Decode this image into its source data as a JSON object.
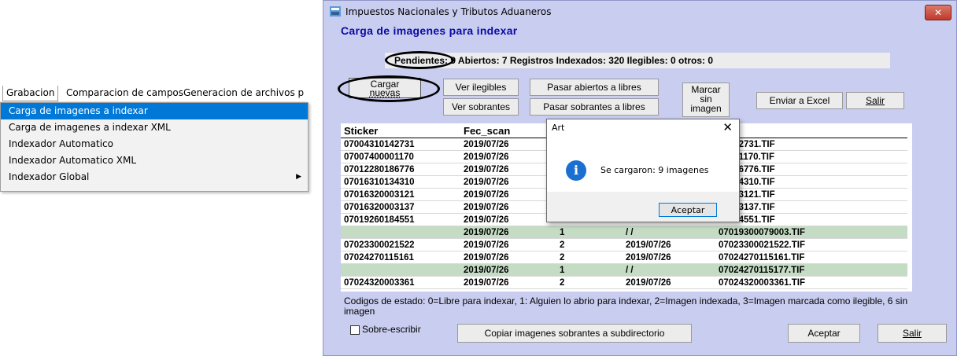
{
  "menubar": {
    "items": [
      "Grabacion",
      "Comparacion de campos",
      "Generacion de archivos p"
    ]
  },
  "dropdown": {
    "items": [
      "Carga de imagenes a indexar",
      "Carga de imagenes a indexar XML",
      "Indexador Automatico",
      "Indexador Automatico XML",
      "Indexador Global"
    ]
  },
  "window": {
    "title": "Impuestos Nacionales y Tributos Aduaneros",
    "close": "✕",
    "subtitle": "Carga de imagenes para indexar",
    "status": "Pendientes: 9 Abiertos: 7 Registros Indexados: 320 Ilegibles: 0 otros: 0"
  },
  "buttons": {
    "cargar_1": "Cargar",
    "cargar_2": "nuevas",
    "ver_ilegibles": "Ver ilegibles",
    "ver_sobrantes": "Ver sobrantes",
    "pasar_abiertos": "Pasar abiertos a libres",
    "pasar_sobrantes": "Pasar sobrantes a libres",
    "marcar_1": "Marcar",
    "marcar_2": "sin",
    "marcar_3": "imagen",
    "enviar_excel": "Enviar a Excel",
    "salir_top": "Salir",
    "copiar": "Copiar imagenes sobrantes a subdirectorio",
    "aceptar": "Aceptar",
    "salir": "Salir"
  },
  "table": {
    "headers": [
      "Sticker",
      "Fec_scan",
      "",
      "",
      "n"
    ],
    "rows": [
      {
        "c": [
          "07004310142731",
          "2019/07/26",
          "",
          "",
          "10142731.TIF"
        ],
        "green": false
      },
      {
        "c": [
          "07007400001170",
          "2019/07/26",
          "",
          "",
          "00001170.TIF"
        ],
        "green": false
      },
      {
        "c": [
          "07012280186776",
          "2019/07/26",
          "",
          "",
          "80186776.TIF"
        ],
        "green": false
      },
      {
        "c": [
          "07016310134310",
          "2019/07/26",
          "",
          "",
          "10134310.TIF"
        ],
        "green": false
      },
      {
        "c": [
          "07016320003121",
          "2019/07/26",
          "",
          "",
          "20003121.TIF"
        ],
        "green": false
      },
      {
        "c": [
          "07016320003137",
          "2019/07/26",
          "",
          "",
          "20003137.TIF"
        ],
        "green": false
      },
      {
        "c": [
          "07019260184551",
          "2019/07/26",
          "",
          "",
          "60184551.TIF"
        ],
        "green": false
      },
      {
        "c": [
          "",
          "2019/07/26",
          "1",
          "/ /",
          "07019300079003.TIF"
        ],
        "green": true
      },
      {
        "c": [
          "07023300021522",
          "2019/07/26",
          "2",
          "2019/07/26",
          "07023300021522.TIF"
        ],
        "green": false
      },
      {
        "c": [
          "07024270115161",
          "2019/07/26",
          "2",
          "2019/07/26",
          "07024270115161.TIF"
        ],
        "green": false
      },
      {
        "c": [
          "",
          "2019/07/26",
          "1",
          "/ /",
          "07024270115177.TIF"
        ],
        "green": true
      },
      {
        "c": [
          "07024320003361",
          "2019/07/26",
          "2",
          "2019/07/26",
          "07024320003361.TIF"
        ],
        "green": false
      }
    ]
  },
  "codes_text": "Codigos de estado: 0=Libre para indexar, 1: Alguien lo abrio para indexar, 2=Imagen indexada, 3=Imagen marcada como ilegible, 6 sin imagen",
  "checkbox_label": "Sobre-escribir",
  "msgbox": {
    "title": "Art",
    "close": "✕",
    "icon": "info-icon",
    "message": "Se cargaron: 9 imagenes",
    "ok": "Aceptar"
  },
  "colors": {
    "window_bg": "#c9cdef",
    "subtitle": "#0a0aa5",
    "menu_highlight": "#0078d7",
    "row_green": "#c4dcc4"
  }
}
